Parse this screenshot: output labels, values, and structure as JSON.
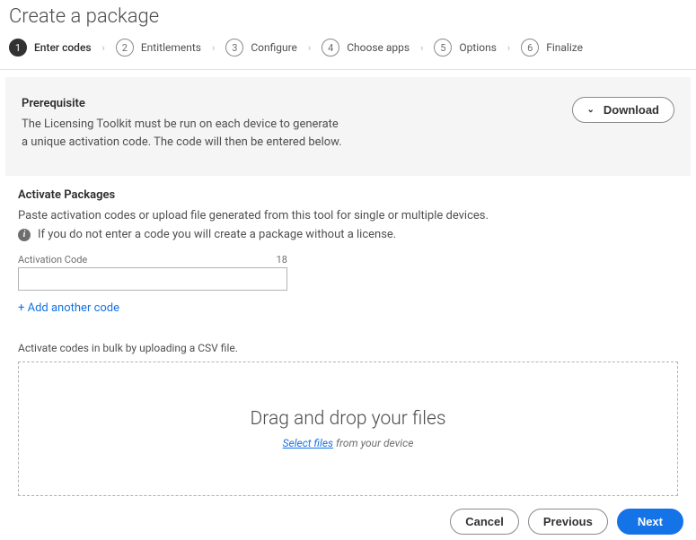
{
  "header": {
    "title": "Create a package"
  },
  "stepper": {
    "steps": [
      {
        "num": "1",
        "label": "Enter codes",
        "active": true
      },
      {
        "num": "2",
        "label": "Entitlements",
        "active": false
      },
      {
        "num": "3",
        "label": "Configure",
        "active": false
      },
      {
        "num": "4",
        "label": "Choose apps",
        "active": false
      },
      {
        "num": "5",
        "label": "Options",
        "active": false
      },
      {
        "num": "6",
        "label": "Finalize",
        "active": false
      }
    ]
  },
  "prereq": {
    "title": "Prerequisite",
    "desc": "The Licensing Toolkit must be run on each device to generate a unique activation code. The code will then be entered below.",
    "download": "Download"
  },
  "activate": {
    "title": "Activate Packages",
    "desc": "Paste activation codes or upload file generated from this tool for single or multiple devices.",
    "info": "If you do not enter a code you will create a package without a license.",
    "field_label": "Activation Code",
    "counter": "18",
    "add_link": "+ Add another code"
  },
  "bulk": {
    "label": "Activate codes in bulk by uploading a CSV file.",
    "drop_title": "Drag and drop your files",
    "select_text": "Select files",
    "sub_suffix": " from your device"
  },
  "footer": {
    "cancel": "Cancel",
    "previous": "Previous",
    "next": "Next"
  }
}
